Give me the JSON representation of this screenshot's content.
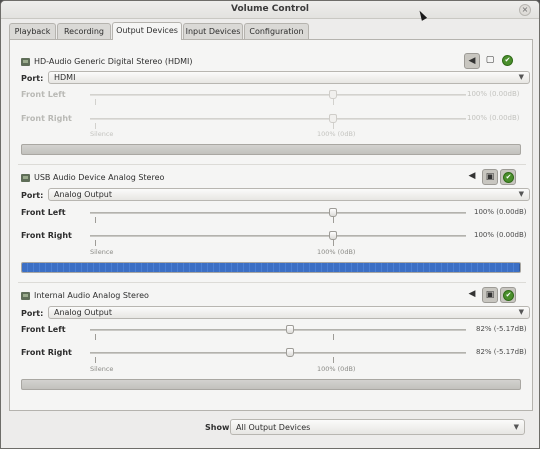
{
  "window": {
    "title": "Volume Control",
    "close_glyph": "×"
  },
  "tabs": [
    {
      "label": "Playback",
      "active": false
    },
    {
      "label": "Recording",
      "active": false
    },
    {
      "label": "Output Devices",
      "active": true
    },
    {
      "label": "Input Devices",
      "active": false
    },
    {
      "label": "Configuration",
      "active": false
    }
  ],
  "devices": [
    {
      "name": "HD-Audio Generic Digital Stereo (HDMI)",
      "enabled": false,
      "port_label": "Port:",
      "port_value": "HDMI",
      "channels": [
        {
          "label": "Front Left",
          "level_percent": 100,
          "value": "100% (0.00dB)"
        },
        {
          "label": "Front Right",
          "level_percent": 100,
          "value": "100% (0.00dB)"
        }
      ],
      "marks": {
        "silence": "Silence",
        "normal": "100% (0dB)"
      },
      "meter_fraction": 0.0,
      "mute_pressed": true,
      "lock_pressed": false,
      "default_pressed": false
    },
    {
      "name": "USB Audio Device Analog Stereo",
      "enabled": true,
      "port_label": "Port:",
      "port_value": "Analog Output",
      "channels": [
        {
          "label": "Front Left",
          "level_percent": 100,
          "value": "100% (0.00dB)"
        },
        {
          "label": "Front Right",
          "level_percent": 100,
          "value": "100% (0.00dB)"
        }
      ],
      "marks": {
        "silence": "Silence",
        "normal": "100% (0dB)"
      },
      "meter_fraction": 1.0,
      "mute_pressed": false,
      "lock_pressed": true,
      "default_pressed": true
    },
    {
      "name": "Internal Audio Analog Stereo",
      "enabled": true,
      "port_label": "Port:",
      "port_value": "Analog Output",
      "channels": [
        {
          "label": "Front Left",
          "level_percent": 82,
          "value": "82% (-5.17dB)"
        },
        {
          "label": "Front Right",
          "level_percent": 82,
          "value": "82% (-5.17dB)"
        }
      ],
      "marks": {
        "silence": "Silence",
        "normal": "100% (0dB)"
      },
      "meter_fraction": 0.0,
      "mute_pressed": false,
      "lock_pressed": true,
      "default_pressed": true
    }
  ],
  "footer": {
    "show_label": "Show:",
    "show_value": "All Output Devices"
  },
  "icons": {
    "speaker": "speaker-icon",
    "lock": "lock-icon",
    "check": "check-icon",
    "dropdown": "chevron-down-icon"
  },
  "colors": {
    "meter_fill": "#3c6fc4",
    "default_check": "#4a8f2c"
  }
}
